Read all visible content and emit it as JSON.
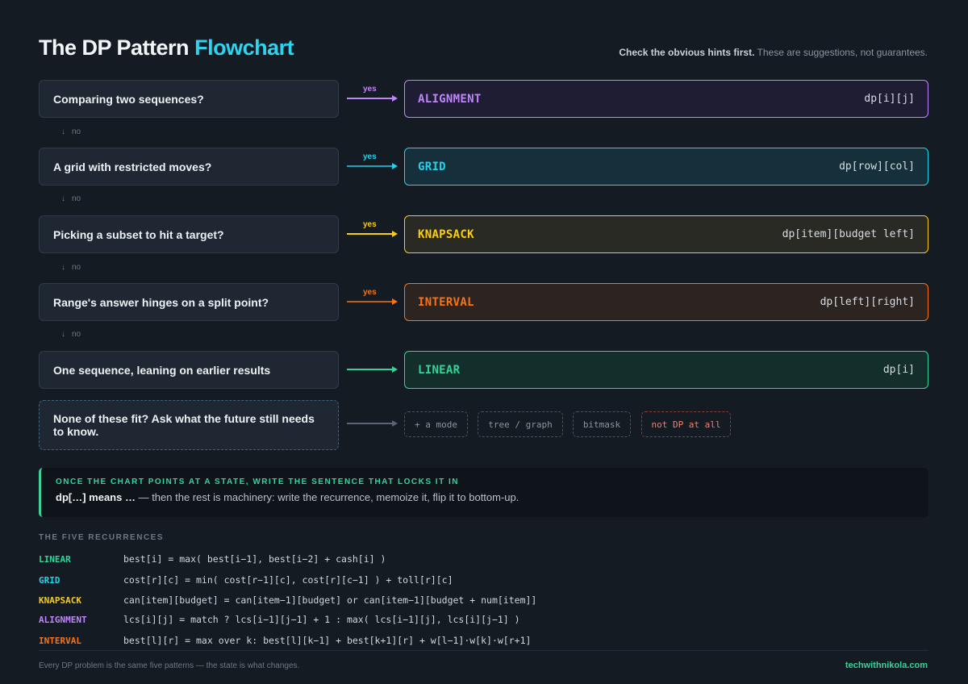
{
  "header": {
    "title": "The DP Pattern",
    "title_accent": "Flowchart",
    "subtitle_bold": "Check the obvious hints first.",
    "subtitle_rest": " These are suggestions, not guarantees."
  },
  "flow": {
    "rows": [
      {
        "question": "Comparing two sequences?",
        "yes_label": "yes",
        "answer": "ALIGNMENT",
        "state": "dp[i][j]",
        "color": "#c084fc",
        "bg": "#1f1d33",
        "no_label": "no"
      },
      {
        "question": "A grid with restricted moves?",
        "yes_label": "yes",
        "answer": "GRID",
        "state": "dp[row][col]",
        "color": "#22d3ee",
        "bg": "#15303a",
        "no_label": "no"
      },
      {
        "question": "Picking a subset to hit a target?",
        "yes_label": "yes",
        "answer": "KNAPSACK",
        "state": "dp[item][budget left]",
        "color": "#facc15",
        "bg": "#2a2a24",
        "no_label": "no"
      },
      {
        "question": "Range's answer hinges on a split point?",
        "yes_label": "yes",
        "answer": "INTERVAL",
        "state": "dp[left][right]",
        "color": "#f97316",
        "bg": "#2c2420",
        "no_label": "no"
      },
      {
        "question": "One sequence, leaning on earlier results",
        "yes_label": "",
        "answer": "LINEAR",
        "state": "dp[i]",
        "color": "#34d399",
        "bg": "#142e2b"
      }
    ],
    "fallback_question": "None of these fit? Ask what the future still needs to know.",
    "fallback_chips": [
      "+ a mode",
      "tree / graph",
      "bitmask",
      "not DP at all"
    ],
    "arrow_down_icon": "down-arrow-icon"
  },
  "callout": {
    "heading": "ONCE THE CHART POINTS AT A STATE, WRITE THE SENTENCE THAT LOCKS IT IN",
    "lead": "dp[…] means …",
    "rest": "  —  then the rest is machinery: write the recurrence, memoize it, flip it to bottom-up."
  },
  "recurrences": {
    "heading": "THE FIVE RECURRENCES",
    "items": [
      {
        "name": "LINEAR",
        "formula": "best[i] = max( best[i−1], best[i−2] + cash[i] )",
        "color": "#34d399"
      },
      {
        "name": "GRID",
        "formula": "cost[r][c] = min( cost[r−1][c], cost[r][c−1] ) + toll[r][c]",
        "color": "#22d3ee"
      },
      {
        "name": "KNAPSACK",
        "formula": "can[item][budget] = can[item−1][budget] or can[item−1][budget + num[item]]",
        "color": "#facc15"
      },
      {
        "name": "ALIGNMENT",
        "formula": "lcs[i][j] = match ? lcs[i−1][j−1] + 1 : max( lcs[i−1][j], lcs[i][j−1] )",
        "color": "#c084fc"
      },
      {
        "name": "INTERVAL",
        "formula": "best[l][r] = max over k: best[l][k−1] + best[k+1][r] + w[l−1]·w[k]·w[r+1]",
        "color": "#f97316"
      }
    ]
  },
  "footer": {
    "left": "Every DP problem is the same five patterns — the state is what changes.",
    "right": "techwithnikola.com"
  }
}
